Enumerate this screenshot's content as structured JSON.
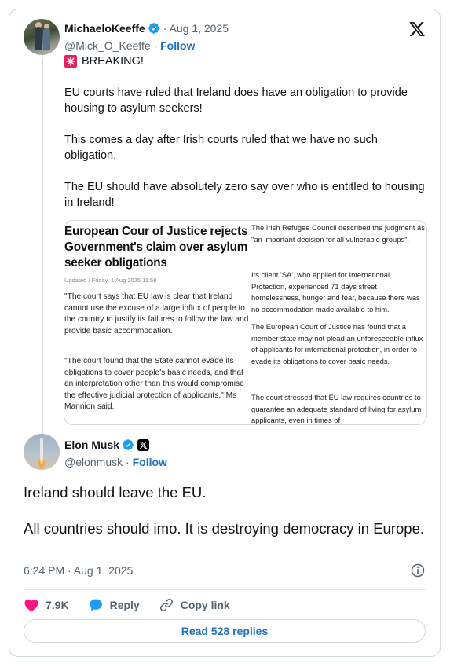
{
  "quoted": {
    "author_name": "MichaeloKeeffe",
    "date": "· Aug 1, 2025",
    "handle": "@Mick_O_Keeffe",
    "separator": " · ",
    "follow_label": "Follow",
    "breaking_label": "BREAKING!",
    "paragraphs": [
      "EU courts have ruled that Ireland does have an obligation to provide housing to asylum seekers!",
      "This comes a day after Irish courts ruled that we have no such obligation.",
      "The EU should have absolutely zero say over who is entitled to housing in Ireland!"
    ],
    "article": {
      "title": "European Cour of Justice rejects Government's claim over asylum seeker obligations",
      "updated": "Updated / Friday, 1 Aug 2025 11:58",
      "left_paragraphs": [
        "\"The court says that EU law is clear that Ireland cannot use the excuse of a large influx of people to the country to justify its failures to follow the law and provide basic accommodation.",
        "\"The court found that the State cannot evade its obligations to cover people's basic needs, and that an interpretation other than this would compromise the effective judicial protection of applicants,\" Ms Mannion said."
      ],
      "right_paragraphs": [
        "The Irish Refugee Council described the judgment as \"an important decision for all vulnerable groups\".",
        "Its client 'SA', who applied for International Protection, experienced 71 days street homelessness, hunger and fear, because there was no accommodation made available to him.",
        "The European Court of Justice has found that a member state may not plead an unforeseeable influx of applicants for international protection, in order to evade its obligations to cover basic needs.",
        "The court stressed that EU law requires countries to guarantee an adequate standard of living for asylum applicants, even in times of"
      ]
    }
  },
  "main": {
    "author_name": "Elon Musk",
    "handle": "@elonmusk",
    "separator": " · ",
    "follow_label": "Follow",
    "paragraphs": [
      "Ireland should leave the EU.",
      "All countries should imo. It is destroying democracy in Europe."
    ],
    "timestamp": "6:24 PM · Aug 1, 2025"
  },
  "actions": {
    "like_count": "7.9K",
    "reply_label": "Reply",
    "copy_link_label": "Copy link"
  },
  "read_replies_label": "Read 528 replies",
  "colors": {
    "accent": "#1d9bf0",
    "link": "#1d72bd",
    "like": "#f91880",
    "muted": "#536471",
    "border": "#cfd9de"
  },
  "icons": [
    "x-logo-icon",
    "verified-badge-icon",
    "siren-icon",
    "x-affiliate-badge-icon",
    "info-icon",
    "heart-icon",
    "reply-bubble-icon",
    "link-icon"
  ]
}
